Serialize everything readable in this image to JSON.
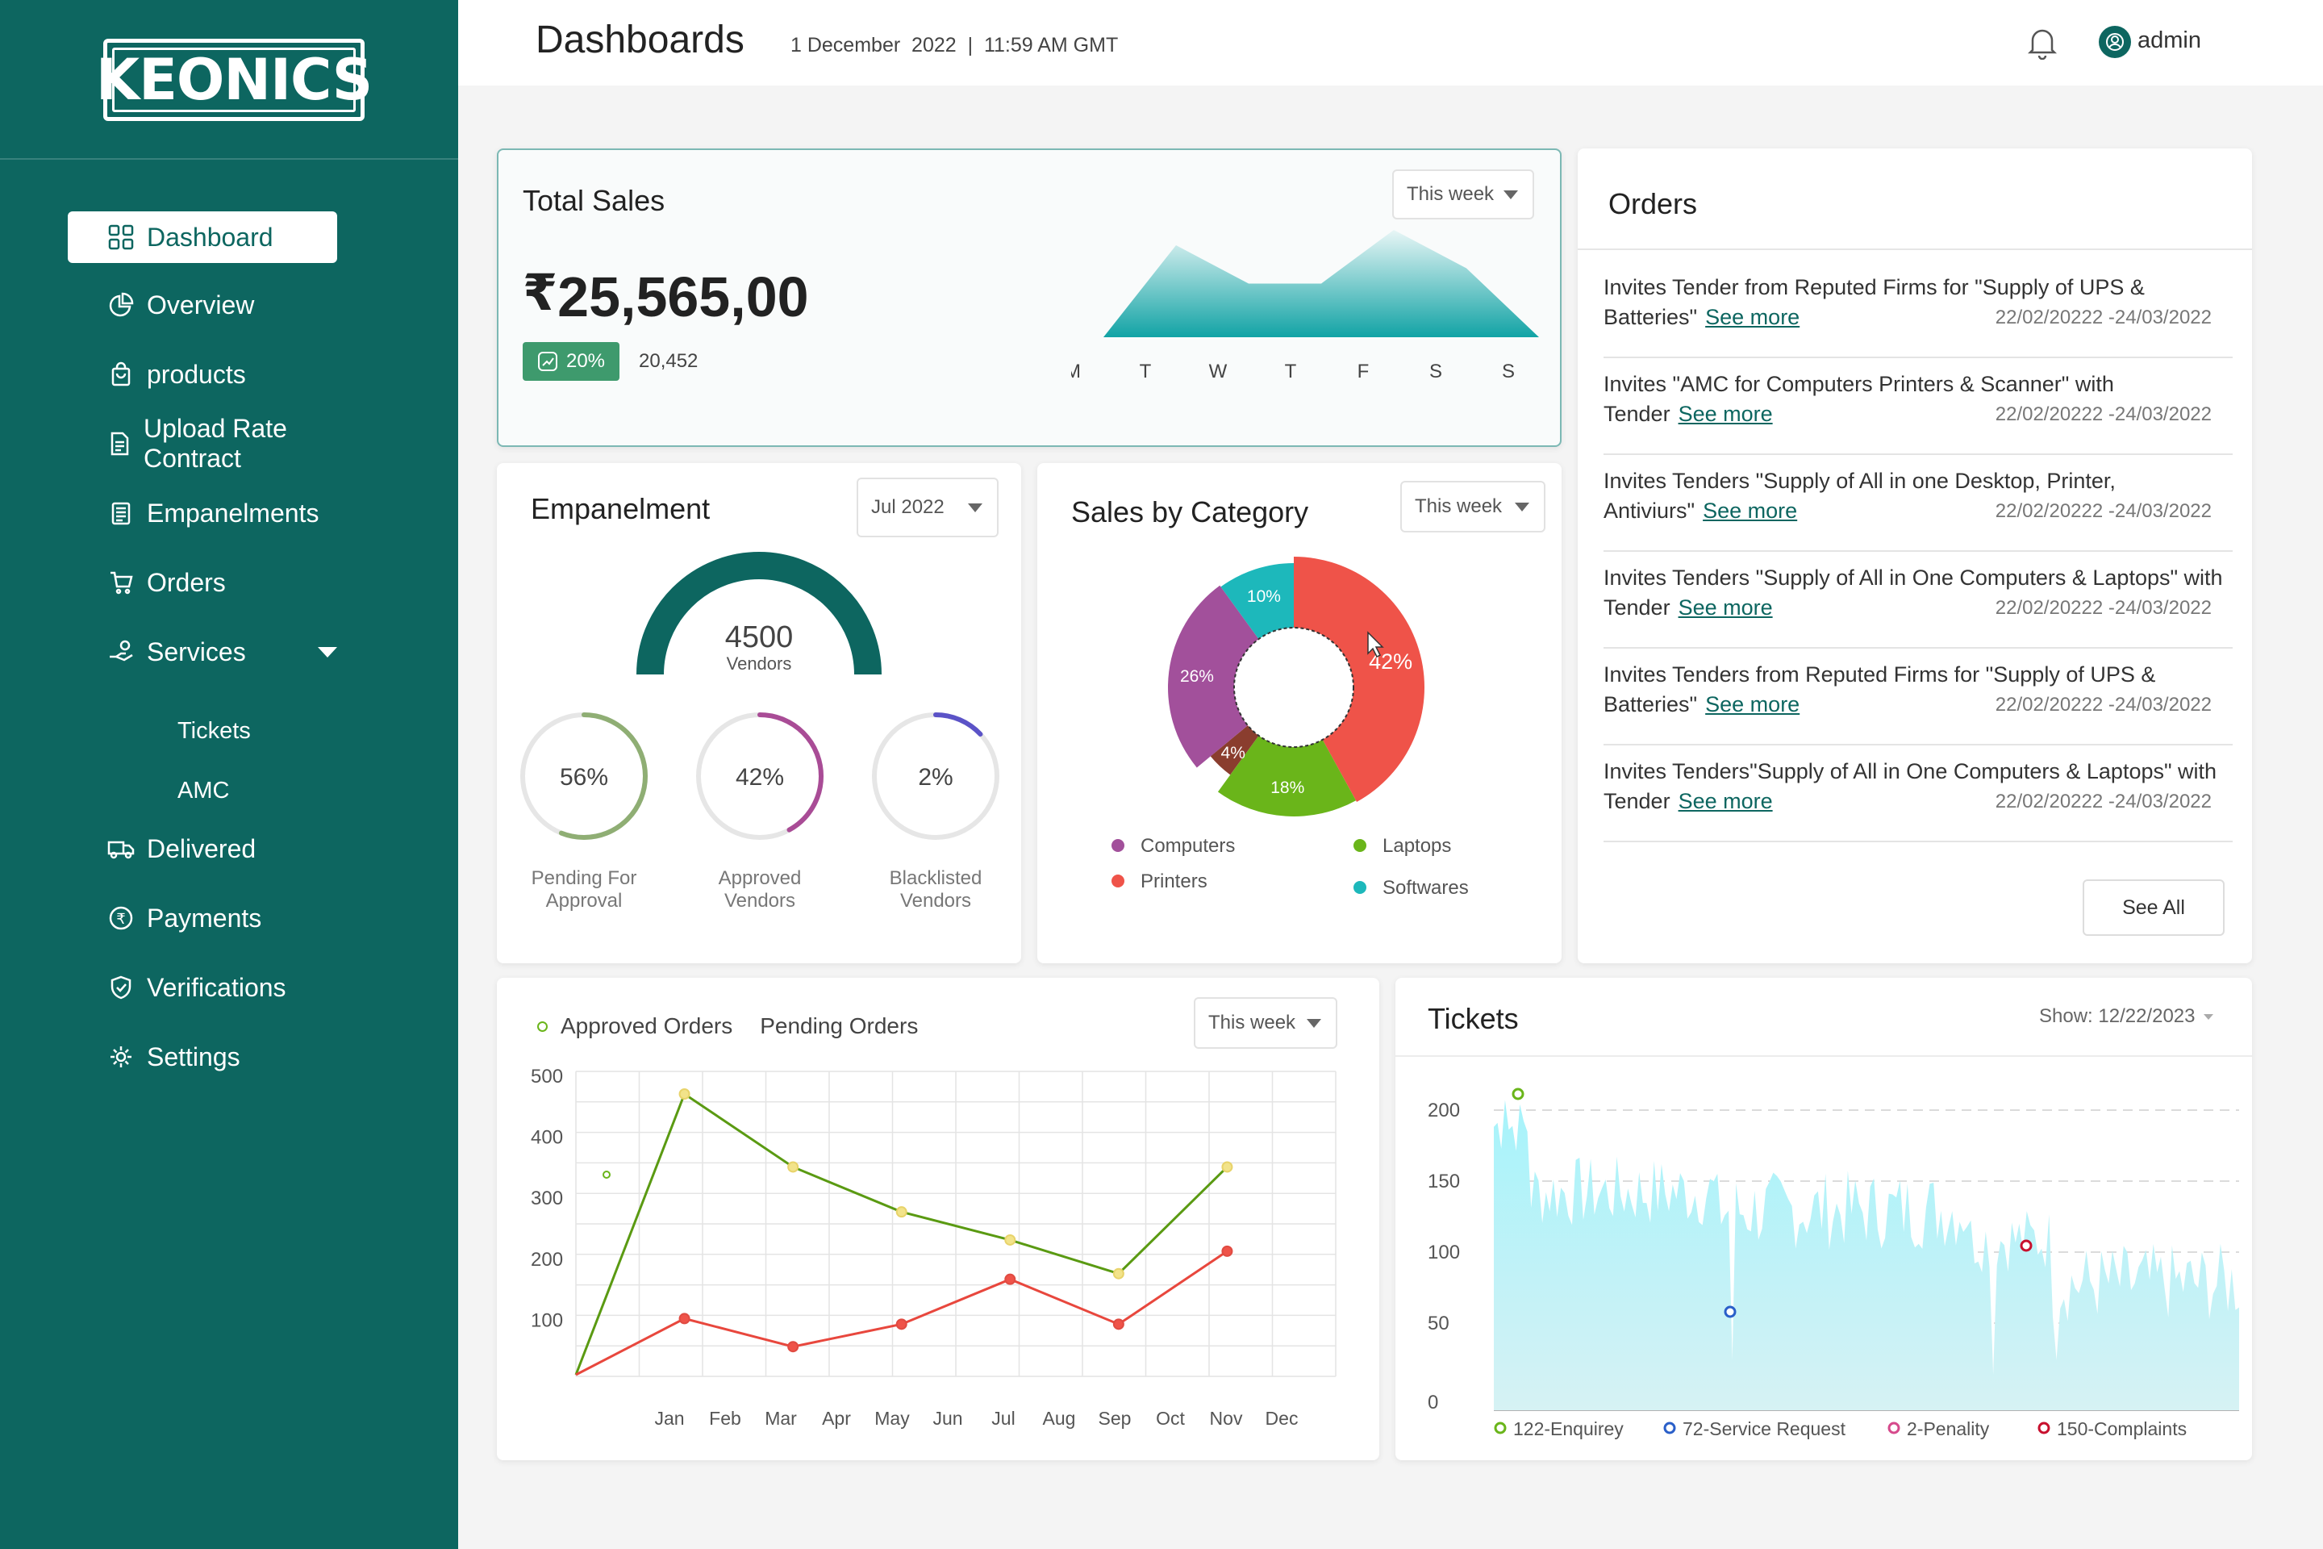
{
  "sidebar": {
    "logo_text": "KEONICS",
    "items": [
      {
        "label": "Dashboard",
        "icon": "grid-icon"
      },
      {
        "label": "Overview",
        "icon": "pie-chart-icon"
      },
      {
        "label": "products",
        "icon": "bag-icon"
      },
      {
        "label": "Upload Rate Contract",
        "icon": "document-icon"
      },
      {
        "label": "Empanelments",
        "icon": "ledger-icon"
      },
      {
        "label": "Orders",
        "icon": "cart-icon"
      },
      {
        "label": "Services",
        "icon": "hand-coins-icon"
      },
      {
        "label": "Tickets"
      },
      {
        "label": "AMC"
      },
      {
        "label": "Delivered",
        "icon": "truck-icon"
      },
      {
        "label": "Payments",
        "icon": "rupee-circle-icon"
      },
      {
        "label": "Verifications",
        "icon": "shield-check-icon"
      },
      {
        "label": "Settings",
        "icon": "gear-icon"
      }
    ]
  },
  "header": {
    "title": "Dashboards",
    "date": "1 December  2022  |  11:59 AM GMT",
    "user": "admin"
  },
  "total_sales": {
    "title": "Total Sales",
    "period": "This week",
    "currency": "₹",
    "amount": "25,565,00",
    "badge": "20%",
    "count": "20,452",
    "chart_data": {
      "type": "area",
      "categories": [
        "M",
        "T",
        "W",
        "T",
        "F",
        "S",
        "S"
      ],
      "values": [
        0,
        60,
        35,
        35,
        70,
        45,
        0
      ]
    }
  },
  "empanelment": {
    "title": "Empanelment",
    "period": "Jul 2022",
    "gauge_value": "4500",
    "gauge_label": "Vendors",
    "circles": [
      {
        "pct": "56%",
        "fraction": 0.56,
        "label1": "Pending For",
        "label2": "Approval",
        "color": "#8fae74"
      },
      {
        "pct": "42%",
        "fraction": 0.42,
        "label1": "Approved",
        "label2": "Vendors",
        "color": "#a94c96"
      },
      {
        "pct": "2%",
        "fraction": 0.13,
        "label1": "Blacklisted",
        "label2": "Vendors",
        "color": "#5b53c7"
      }
    ]
  },
  "category": {
    "title": "Sales by Category",
    "period": "This week",
    "chart_data": {
      "type": "pie",
      "slices": [
        {
          "label": "42%",
          "value": 42,
          "color": "#ef5349"
        },
        {
          "label": "18%",
          "value": 18,
          "color": "#6ab51a"
        },
        {
          "label": "4%",
          "value": 4,
          "color": "#8a3d2e"
        },
        {
          "label": "26%",
          "value": 26,
          "color": "#a2509b"
        },
        {
          "label": "10%",
          "value": 10,
          "color": "#1db8bb"
        }
      ],
      "legend": [
        {
          "label": "Computers",
          "color": "#a2509b"
        },
        {
          "label": "Laptops",
          "color": "#6ab51a"
        },
        {
          "label": "Printers",
          "color": "#ef5349"
        },
        {
          "label": "Softwares",
          "color": "#1db8bb"
        }
      ]
    }
  },
  "orders": {
    "title": "Orders",
    "see_more": "See more",
    "see_all": "See All",
    "items": [
      {
        "text": "Invites Tender from Reputed Firms for \"Supply of UPS & Batteries\"",
        "date": "22/02/20222 -24/03/2022"
      },
      {
        "text": "Invites \"AMC for Computers Printers & Scanner\" with Tender",
        "date": "22/02/20222 -24/03/2022"
      },
      {
        "text": "Invites Tenders \"Supply of All in one Desktop, Printer, Antiviurs\"",
        "date": "22/02/20222 -24/03/2022"
      },
      {
        "text": "Invites Tenders \"Supply of All in One Computers & Laptops\" with Tender",
        "date": "22/02/20222 -24/03/2022"
      },
      {
        "text": "Invites Tenders from Reputed Firms for \"Supply of UPS & Batteries\"",
        "date": "22/02/20222 -24/03/2022"
      },
      {
        "text": "Invites Tenders\"Supply of All in One Computers & Laptops\" with Tender",
        "date": "22/02/20222 -24/03/2022"
      }
    ]
  },
  "orders_chart": {
    "period": "This week",
    "legend_approved": "Approved Orders",
    "legend_pending": "Pending Orders",
    "chart_data": {
      "type": "line",
      "categories": [
        "Jan",
        "Feb",
        "Mar",
        "Apr",
        "May",
        "Jun",
        "Jul",
        "Aug",
        "Sep",
        "Oct",
        "Nov",
        "Dec"
      ],
      "y_ticks": [
        "500",
        "400",
        "300",
        "200",
        "100"
      ],
      "ylim": [
        0,
        500
      ],
      "series": [
        {
          "name": "Approved Orders",
          "color": "#5a9a12",
          "x": [
            0,
            2,
            4,
            6,
            8,
            10,
            12,
            13
          ],
          "y": [
            0,
            500,
            370,
            290,
            240,
            180,
            370,
            370
          ]
        },
        {
          "name": "Pending Orders",
          "color": "#e8473d",
          "x": [
            0,
            2,
            4,
            6,
            8,
            10,
            12
          ],
          "y": [
            0,
            100,
            50,
            90,
            170,
            90,
            220
          ]
        }
      ]
    }
  },
  "tickets": {
    "title": "Tickets",
    "show": "Show: 12/22/2023",
    "chart_data": {
      "type": "area",
      "y_ticks": [
        "200",
        "150",
        "100",
        "50",
        "0"
      ],
      "ylim": [
        0,
        200
      ],
      "legend": [
        {
          "label": "122-Enquirey",
          "color": "#6ab51a"
        },
        {
          "label": "72-Service Request",
          "color": "#2a5fc9"
        },
        {
          "label": "2-Penality",
          "color": "#d64a8c"
        },
        {
          "label": "150-Complaints",
          "color": "#c8102e"
        }
      ]
    }
  }
}
